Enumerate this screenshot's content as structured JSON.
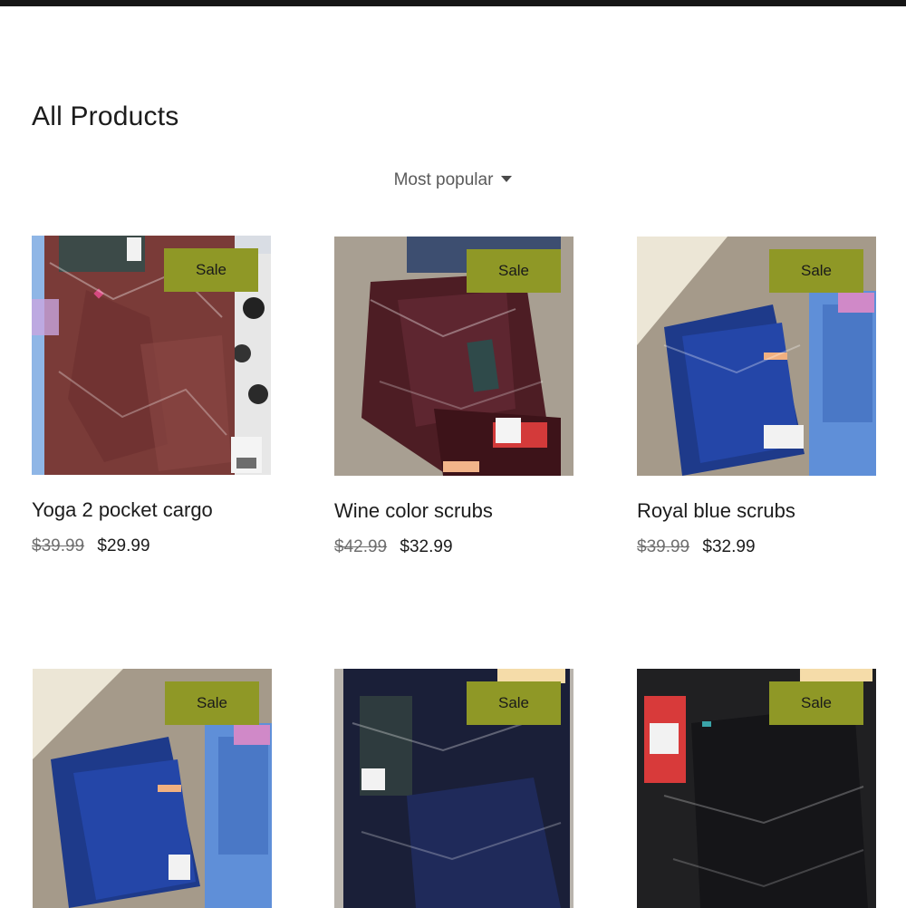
{
  "page": {
    "title": "All Products"
  },
  "sort": {
    "selected": "Most popular"
  },
  "products": [
    {
      "name": "Yoga 2 pocket cargo",
      "badge": "Sale",
      "price_old": "$39.99",
      "price_new": "$29.99",
      "image_icon": "burgundy-pants-in-plastic"
    },
    {
      "name": "Wine color scrubs",
      "badge": "Sale",
      "price_old": "$42.99",
      "price_new": "$32.99",
      "image_icon": "wine-scrubs-on-carpet"
    },
    {
      "name": "Royal blue scrubs",
      "badge": "Sale",
      "price_old": "$39.99",
      "price_new": "$32.99",
      "image_icon": "blue-scrubs-on-carpet"
    },
    {
      "name": "",
      "badge": "Sale",
      "price_old": "",
      "price_new": "",
      "image_icon": "blue-scrubs-on-carpet"
    },
    {
      "name": "",
      "badge": "Sale",
      "price_old": "",
      "price_new": "",
      "image_icon": "navy-scrubs-in-plastic"
    },
    {
      "name": "",
      "badge": "Sale",
      "price_old": "",
      "price_new": "",
      "image_icon": "black-scrubs-in-plastic"
    }
  ],
  "colors": {
    "badge_bg": "#8f9826",
    "topbar": "#161616"
  }
}
